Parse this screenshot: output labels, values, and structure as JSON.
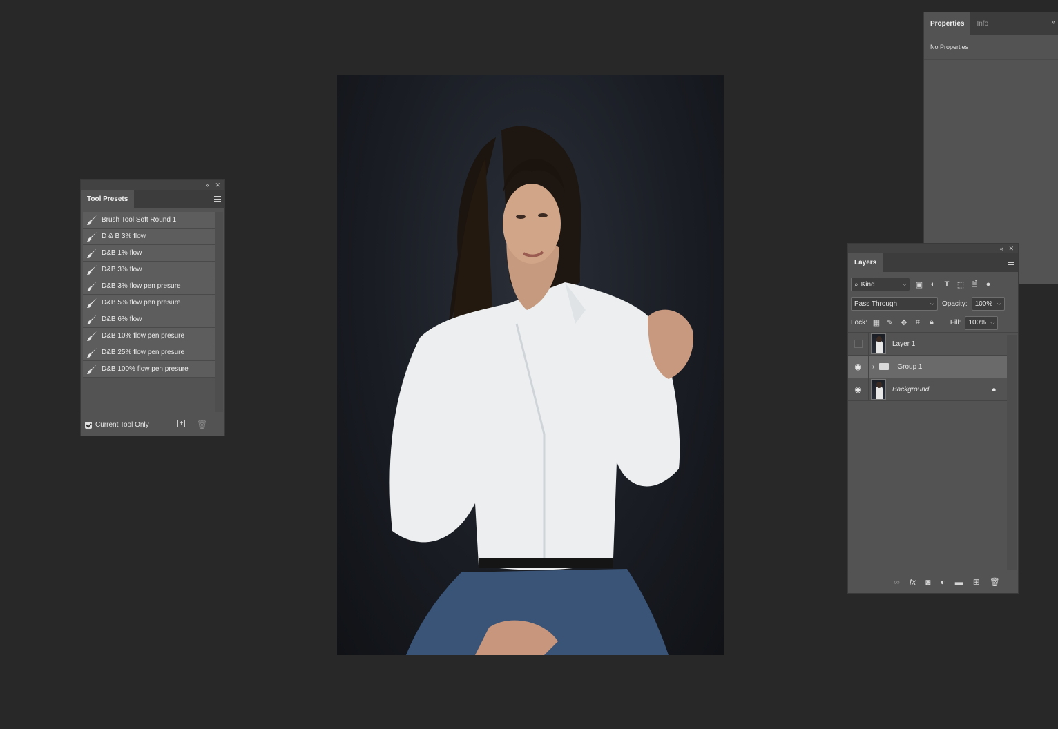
{
  "tool_presets": {
    "tab": "Tool Presets",
    "items": [
      "Brush Tool Soft Round 1",
      "D & B 3% flow",
      "D&B 1% flow",
      "D&B 3% flow",
      "D&B 3% flow pen presure",
      "D&B 5% flow pen presure",
      "D&B 6% flow",
      "D&B 10% flow pen presure",
      "D&B 25% flow pen presure",
      "D&B 100% flow pen presure"
    ],
    "current_tool_only": "Current Tool Only"
  },
  "properties": {
    "tabs": [
      "Properties",
      "Info"
    ],
    "message": "No Properties"
  },
  "layers": {
    "tab": "Layers",
    "filter": "Kind",
    "blend_mode": "Pass Through",
    "opacity_label": "Opacity:",
    "opacity": "100%",
    "lock_label": "Lock:",
    "fill_label": "Fill:",
    "fill": "100%",
    "items": [
      {
        "name": "Layer 1"
      },
      {
        "name": "Group 1"
      },
      {
        "name": "Background"
      }
    ]
  },
  "icons": {
    "collapse": "double-chevron-left-icon",
    "close": "close-icon",
    "expand": "double-chevron-right-icon"
  }
}
